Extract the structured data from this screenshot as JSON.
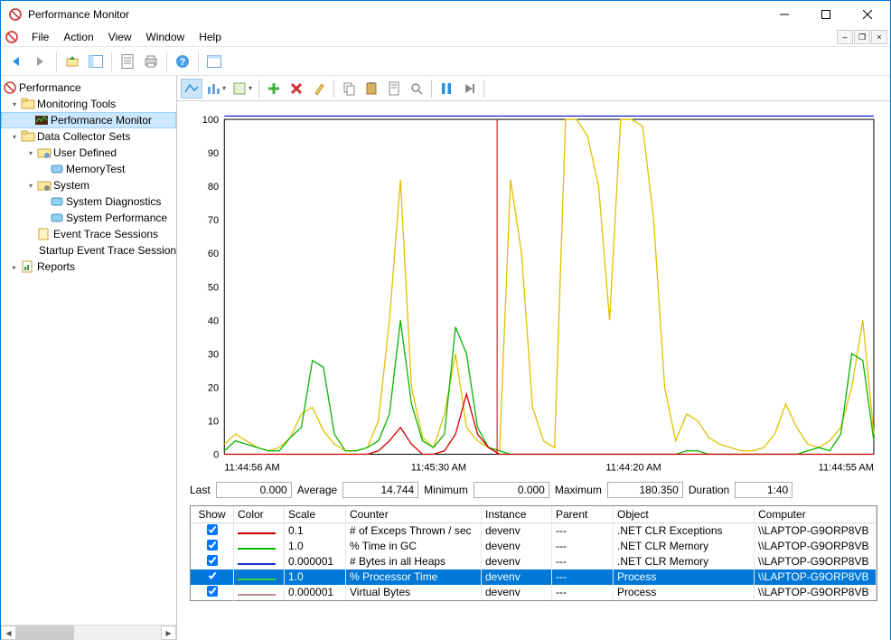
{
  "window": {
    "title": "Performance Monitor"
  },
  "menu": {
    "file": "File",
    "action": "Action",
    "view": "View",
    "window": "Window",
    "help": "Help"
  },
  "tree": {
    "root": "Performance",
    "monitoring_tools": "Monitoring Tools",
    "performance_monitor": "Performance Monitor",
    "data_collector_sets": "Data Collector Sets",
    "user_defined": "User Defined",
    "memory_test": "MemoryTest",
    "system": "System",
    "system_diagnostics": "System Diagnostics",
    "system_performance": "System Performance",
    "event_trace": "Event Trace Sessions",
    "startup_event_trace": "Startup Event Trace Sessions",
    "reports": "Reports"
  },
  "stats": {
    "last_label": "Last",
    "last": "0.000",
    "avg_label": "Average",
    "avg": "14.744",
    "min_label": "Minimum",
    "min": "0.000",
    "max_label": "Maximum",
    "max": "180.350",
    "dur_label": "Duration",
    "dur": "1:40"
  },
  "table": {
    "headers": {
      "show": "Show",
      "color": "Color",
      "scale": "Scale",
      "counter": "Counter",
      "instance": "Instance",
      "parent": "Parent",
      "object": "Object",
      "computer": "Computer"
    },
    "rows": [
      {
        "color": "#d00000",
        "scale": "0.1",
        "counter": "# of Exceps Thrown / sec",
        "instance": "devenv",
        "parent": "---",
        "object": ".NET CLR Exceptions",
        "computer": "\\\\LAPTOP-G9ORP8VB"
      },
      {
        "color": "#09b400",
        "scale": "1.0",
        "counter": "% Time in GC",
        "instance": "devenv",
        "parent": "---",
        "object": ".NET CLR Memory",
        "computer": "\\\\LAPTOP-G9ORP8VB"
      },
      {
        "color": "#1726d1",
        "scale": "0.000001",
        "counter": "# Bytes in all Heaps",
        "instance": "devenv",
        "parent": "---",
        "object": ".NET CLR Memory",
        "computer": "\\\\LAPTOP-G9ORP8VB"
      },
      {
        "color": "#3dd13d",
        "scale": "1.0",
        "counter": "% Processor Time",
        "instance": "devenv",
        "parent": "---",
        "object": "Process",
        "computer": "\\\\LAPTOP-G9ORP8VB",
        "selected": true
      },
      {
        "color": "#c08b8b",
        "scale": "0.000001",
        "counter": "Virtual Bytes",
        "instance": "devenv",
        "parent": "---",
        "object": "Process",
        "computer": "\\\\LAPTOP-G9ORP8VB"
      }
    ]
  },
  "chart_data": {
    "type": "line",
    "ylim": [
      0,
      100
    ],
    "yticks": [
      0,
      10,
      20,
      30,
      40,
      50,
      60,
      70,
      80,
      90,
      100
    ],
    "x_labels_visible": [
      "11:44:56 AM",
      "11:45:30 AM",
      "11:44:20 AM",
      "11:44:55 AM"
    ],
    "cursor_x_fraction": 0.42,
    "series": [
      {
        "name": "# Bytes in all Heaps",
        "color": "#1726d1",
        "values": [
          101,
          101,
          101,
          101,
          101,
          101,
          101,
          101,
          101,
          101,
          101,
          101,
          101,
          101,
          101,
          101,
          101,
          101,
          101,
          101,
          101,
          101,
          101,
          101,
          101,
          101,
          101,
          101,
          101,
          101,
          101,
          101,
          101,
          101,
          101,
          101,
          101,
          101,
          101,
          101,
          101,
          101,
          101,
          101,
          101,
          101,
          101,
          101,
          101,
          101,
          101,
          101,
          101,
          101,
          101,
          101,
          101,
          101,
          101,
          101
        ]
      },
      {
        "name": "% Processor Time",
        "color": "#e0c000",
        "values": [
          3,
          6,
          4,
          2,
          1,
          2,
          5,
          12,
          14,
          7,
          3,
          1,
          1,
          2,
          10,
          40,
          82,
          20,
          5,
          2,
          12,
          30,
          8,
          4,
          2,
          1,
          82,
          60,
          14,
          4,
          2,
          100,
          100,
          95,
          80,
          40,
          100,
          100,
          98,
          70,
          20,
          4,
          12,
          10,
          5,
          3,
          2,
          1,
          1,
          2,
          6,
          15,
          8,
          3,
          2,
          4,
          8,
          20,
          40,
          6
        ]
      },
      {
        "name": "% Time in GC",
        "color": "#09b400",
        "values": [
          1,
          4,
          3,
          2,
          1,
          1,
          5,
          8,
          28,
          26,
          6,
          1,
          1,
          2,
          4,
          12,
          40,
          15,
          4,
          2,
          6,
          38,
          30,
          8,
          2,
          1,
          0,
          0,
          0,
          0,
          0,
          0,
          0,
          0,
          0,
          0,
          0,
          0,
          0,
          0,
          0,
          0,
          1,
          1,
          0,
          0,
          0,
          0,
          0,
          0,
          0,
          0,
          0,
          1,
          2,
          1,
          6,
          30,
          28,
          4
        ]
      },
      {
        "name": "# of Exceps Thrown / sec",
        "color": "#d00000",
        "values": [
          0,
          0,
          0,
          0,
          0,
          0,
          0,
          0,
          0,
          0,
          0,
          0,
          0,
          0,
          1,
          4,
          8,
          3,
          0,
          0,
          1,
          6,
          18,
          6,
          2,
          0,
          0,
          0,
          0,
          0,
          0,
          0,
          0,
          0,
          0,
          0,
          0,
          0,
          0,
          0,
          0,
          0,
          0,
          0,
          0,
          0,
          0,
          0,
          0,
          0,
          0,
          0,
          0,
          0,
          0,
          0,
          0,
          0,
          0,
          0
        ]
      }
    ]
  }
}
